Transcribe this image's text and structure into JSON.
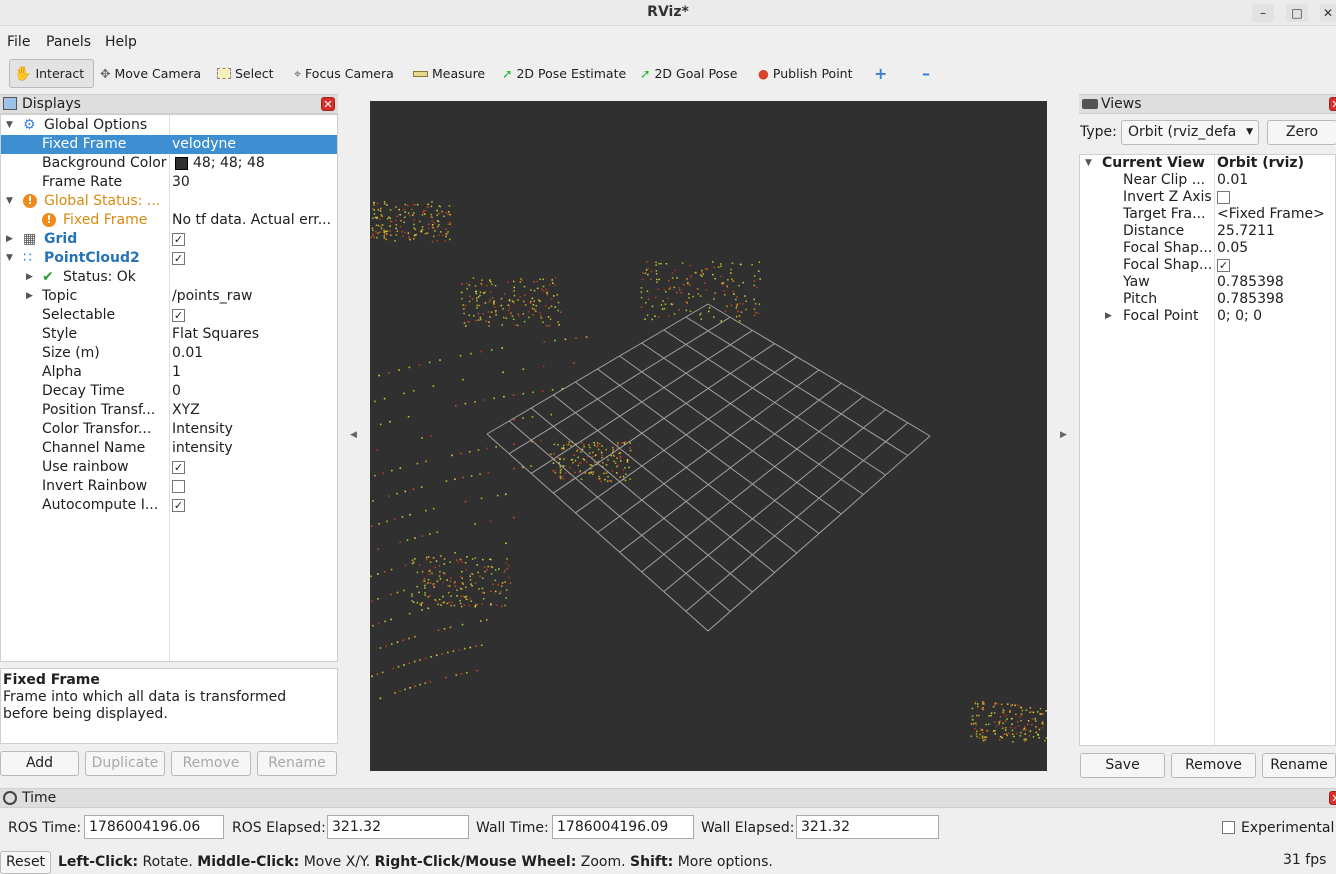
{
  "window": {
    "title": "RViz*",
    "minimize_icon": "minimize-icon",
    "maximize_icon": "maximize-icon",
    "close_icon": "close-icon"
  },
  "menu": [
    "File",
    "Panels",
    "Help"
  ],
  "toolbar": [
    {
      "label": "Interact",
      "icon": "hand-icon",
      "active": true
    },
    {
      "label": "Move Camera",
      "icon": "move-camera-icon"
    },
    {
      "label": "Select",
      "icon": "select-icon"
    },
    {
      "label": "Focus Camera",
      "icon": "focus-camera-icon"
    },
    {
      "label": "Measure",
      "icon": "ruler-icon"
    },
    {
      "label": "2D Pose Estimate",
      "icon": "arrow-green-icon"
    },
    {
      "label": "2D Goal Pose",
      "icon": "arrow-green-icon"
    },
    {
      "label": "Publish Point",
      "icon": "pin-icon"
    }
  ],
  "displays": {
    "title": "Displays",
    "rows": [
      {
        "label": "Global Options",
        "value": ""
      },
      {
        "label": "Fixed Frame",
        "value": "velodyne"
      },
      {
        "label": "Background Color",
        "value": "48; 48; 48"
      },
      {
        "label": "Frame Rate",
        "value": "30"
      },
      {
        "label": "Global Status: ...",
        "value": ""
      },
      {
        "label": "Fixed Frame",
        "value": "No tf data.  Actual err..."
      },
      {
        "label": "Grid",
        "value": ""
      },
      {
        "label": "PointCloud2",
        "value": ""
      },
      {
        "label": "Status: Ok",
        "value": ""
      },
      {
        "label": "Topic",
        "value": "/points_raw"
      },
      {
        "label": "Selectable",
        "value": ""
      },
      {
        "label": "Style",
        "value": "Flat Squares"
      },
      {
        "label": "Size (m)",
        "value": "0.01"
      },
      {
        "label": "Alpha",
        "value": "1"
      },
      {
        "label": "Decay Time",
        "value": "0"
      },
      {
        "label": "Position Transf...",
        "value": "XYZ"
      },
      {
        "label": "Color Transfor...",
        "value": "Intensity"
      },
      {
        "label": "Channel Name",
        "value": "intensity"
      },
      {
        "label": "Use rainbow",
        "value": ""
      },
      {
        "label": "Invert Rainbow",
        "value": ""
      },
      {
        "label": "Autocompute I...",
        "value": ""
      }
    ],
    "help_title": "Fixed Frame",
    "help_text": "Frame into which all data is transformed before being displayed.",
    "buttons": [
      "Add",
      "Duplicate",
      "Remove",
      "Rename"
    ]
  },
  "views": {
    "title": "Views",
    "type_label": "Type:",
    "type_value": "Orbit (rviz_default_plugins)",
    "zero_label": "Zero",
    "rows": [
      {
        "label": "Current View",
        "value": "Orbit (rviz)"
      },
      {
        "label": "Near Clip ...",
        "value": "0.01"
      },
      {
        "label": "Invert Z Axis",
        "value": ""
      },
      {
        "label": "Target Fra...",
        "value": "<Fixed Frame>"
      },
      {
        "label": "Distance",
        "value": "25.7211"
      },
      {
        "label": "Focal Shap...",
        "value": "0.05"
      },
      {
        "label": "Focal Shap...",
        "value": ""
      },
      {
        "label": "Yaw",
        "value": "0.785398"
      },
      {
        "label": "Pitch",
        "value": "0.785398"
      },
      {
        "label": "Focal Point",
        "value": "0; 0; 0"
      }
    ],
    "buttons": [
      "Save",
      "Remove",
      "Rename"
    ]
  },
  "time": {
    "title": "Time",
    "ros_time_label": "ROS Time:",
    "ros_time": "1786004196.06",
    "ros_elapsed_label": "ROS Elapsed:",
    "ros_elapsed": "321.32",
    "wall_time_label": "Wall Time:",
    "wall_time": "1786004196.09",
    "wall_elapsed_label": "Wall Elapsed:",
    "wall_elapsed": "321.32",
    "experimental_label": "Experimental"
  },
  "status": {
    "reset_label": "Reset",
    "hint_1b": "Left-Click:",
    "hint_1": " Rotate. ",
    "hint_2b": "Middle-Click:",
    "hint_2": " Move X/Y. ",
    "hint_3b": "Right-Click/Mouse Wheel:",
    "hint_3": " Zoom. ",
    "hint_4b": "Shift:",
    "hint_4": " More options.",
    "fps": "31 fps"
  },
  "colors": {
    "viewport_bg": "#303030",
    "selection": "#3d8fd1",
    "grid": "#a0a0a0"
  }
}
